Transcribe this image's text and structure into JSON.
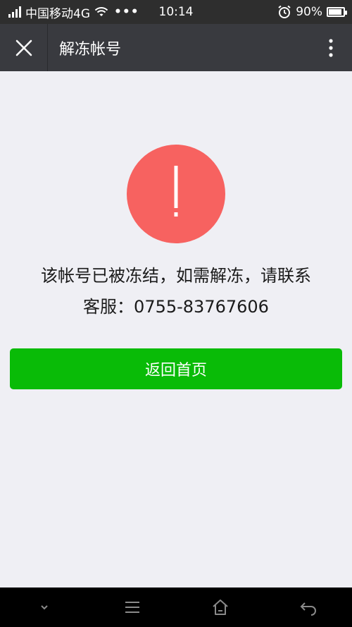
{
  "status_bar": {
    "carrier": "中国移动4G",
    "time": "10:14",
    "battery": "90%",
    "battery_level": 0.9
  },
  "title_bar": {
    "title": "解冻帐号"
  },
  "content": {
    "message_line1": "该帐号已被冻结，如需解冻，请联系",
    "message_line2": "客服：0755-83767606",
    "button_label": "返回首页"
  },
  "icons": {
    "status": [
      "signal-icon",
      "wifi-icon",
      "more-dots-icon",
      "alarm-icon",
      "battery-icon"
    ],
    "title": [
      "close-icon",
      "more-vertical-icon"
    ],
    "content": [
      "warning-icon"
    ],
    "nav": [
      "chevron-down-icon",
      "menu-icon",
      "home-icon",
      "back-icon"
    ]
  },
  "colors": {
    "status_bar_bg": "#2e2e2e",
    "title_bar_bg": "#393a3f",
    "page_bg": "#efeff4",
    "warning_red": "#f76260",
    "primary_green": "#09bb07",
    "nav_bg": "#000000"
  }
}
